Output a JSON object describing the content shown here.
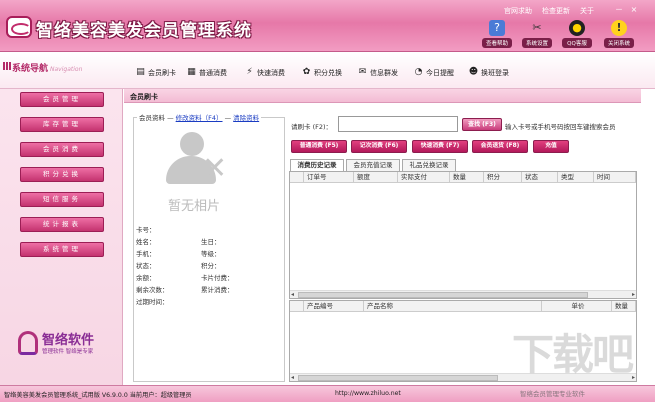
{
  "app": {
    "title": "智络美容美发会员管理系统",
    "top_links": [
      "官网求助",
      "检查更新",
      "关于"
    ],
    "window_controls": [
      "－",
      "×"
    ],
    "quick_tools": [
      {
        "label": "查看帮助",
        "icon": "help-book-icon"
      },
      {
        "label": "系统设置",
        "icon": "tools-icon"
      },
      {
        "label": "QQ客服",
        "icon": "qq-penguin-icon"
      },
      {
        "label": "关闭系统",
        "icon": "warning-icon"
      }
    ]
  },
  "toolbar": {
    "nav_title": "系统导航",
    "nav_title_en": "Navigation",
    "buttons": [
      "会员刷卡",
      "普通消费",
      "快速消费",
      "积分兑换",
      "信息群发",
      "今日提醒",
      "换班登录"
    ]
  },
  "sidebar": {
    "items": [
      "会员管理",
      "库存管理",
      "会员消费",
      "积分兑换",
      "短信服务",
      "统计报表",
      "系统管理"
    ],
    "logo_title": "智络软件",
    "logo_slogan": "管理软件 智络是专家"
  },
  "panel": {
    "title": "会员刷卡",
    "info_label": "会员资料",
    "edit_link": "修改资料（F4）",
    "clear_link": "清除资料",
    "photo_caption": "暂无相片",
    "fields_left": [
      "卡号：",
      "姓名：",
      "手机：",
      "状态：",
      "余额：",
      "剩余次数：",
      "过期时间："
    ],
    "fields_right": [
      "生日：",
      "等级：",
      "积分：",
      "卡片付费：",
      "累计消费："
    ],
    "search_label": "请刷卡 (F2)：",
    "search_placeholder": "",
    "search_button": "查找 (F3)",
    "search_hint": "输入卡号或手机号码按回车键搜索会员",
    "actions": [
      "普通消费 (F5)",
      "记次消费 (F6)",
      "快速消费 (F7)",
      "会员退货 (F8)",
      "充值"
    ],
    "tabs": [
      "消费历史记录",
      "会员充值记录",
      "礼品兑换记录"
    ],
    "grid1_columns": [
      "订单号",
      "额度",
      "实际支付",
      "数量",
      "积分",
      "状态",
      "类型",
      "时间"
    ],
    "grid2_columns": [
      "产品编号",
      "产品名称",
      "单价",
      "数量"
    ]
  },
  "status": {
    "text": "智络美容美发会员管理系统_试用版  V6.9.0.0  当前用户：超级管理员",
    "url": "http://www.zhiluo.net"
  },
  "watermark": {
    "big": "下载吧",
    "sub": "智络会员管理专业软件"
  },
  "colors": {
    "brand": "#e678a8",
    "accent": "#c4336f",
    "link": "#1a3cc2"
  }
}
